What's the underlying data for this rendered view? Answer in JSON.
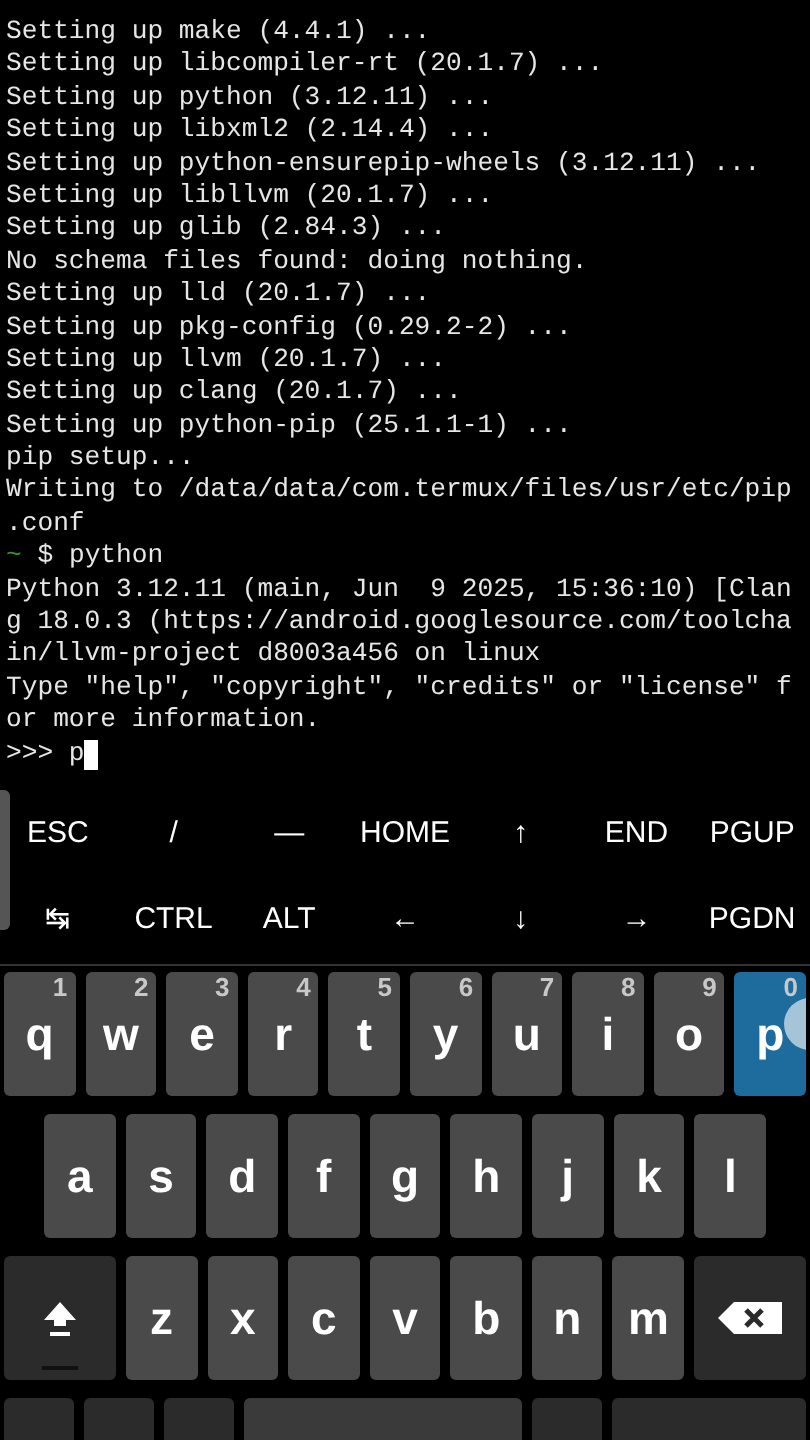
{
  "terminal": {
    "lines": [
      {
        "text": "Setting up make (4.4.1) ..."
      },
      {
        "text": "Setting up libcompiler-rt (20.1.7) ..."
      },
      {
        "text": "Setting up python (3.12.11) ..."
      },
      {
        "text": "Setting up libxml2 (2.14.4) ..."
      },
      {
        "text": "Setting up python-ensurepip-wheels (3.12.11) ..."
      },
      {
        "text": "Setting up libllvm (20.1.7) ..."
      },
      {
        "text": "Setting up glib (2.84.3) ..."
      },
      {
        "text": "No schema files found: doing nothing."
      },
      {
        "text": "Setting up lld (20.1.7) ..."
      },
      {
        "text": "Setting up pkg-config (0.29.2-2) ..."
      },
      {
        "text": "Setting up llvm (20.1.7) ..."
      },
      {
        "text": "Setting up clang (20.1.7) ..."
      },
      {
        "text": "Setting up python-pip (25.1.1-1) ..."
      },
      {
        "text": "pip setup..."
      },
      {
        "text": "Writing to /data/data/com.termux/files/usr/etc/pip"
      },
      {
        "text": ".conf"
      },
      {
        "prompt": "~",
        "text": "$ python"
      },
      {
        "text": "Python 3.12.11 (main, Jun  9 2025, 15:36:10) [Clan"
      },
      {
        "text": "g 18.0.3 (https://android.googlesource.com/toolcha"
      },
      {
        "text": "in/llvm-project d8003a456 on linux"
      },
      {
        "text": "Type \"help\", \"copyright\", \"credits\" or \"license\" f"
      },
      {
        "text": "or more information."
      },
      {
        "text": ">>> p",
        "cursor": true
      }
    ]
  },
  "extra_keys": [
    [
      "ESC",
      "/",
      "―",
      "HOME",
      "↑",
      "END",
      "PGUP"
    ],
    [
      "↹",
      "CTRL",
      "ALT",
      "←",
      "↓",
      "→",
      "PGDN"
    ]
  ],
  "keyboard": {
    "rows": [
      [
        {
          "kind": "letter",
          "label": "q",
          "hint": "1",
          "pressed": false
        },
        {
          "kind": "letter",
          "label": "w",
          "hint": "2",
          "pressed": false
        },
        {
          "kind": "letter",
          "label": "e",
          "hint": "3",
          "pressed": false
        },
        {
          "kind": "letter",
          "label": "r",
          "hint": "4",
          "pressed": false
        },
        {
          "kind": "letter",
          "label": "t",
          "hint": "5",
          "pressed": false
        },
        {
          "kind": "letter",
          "label": "y",
          "hint": "6",
          "pressed": false
        },
        {
          "kind": "letter",
          "label": "u",
          "hint": "7",
          "pressed": false
        },
        {
          "kind": "letter",
          "label": "i",
          "hint": "8",
          "pressed": false
        },
        {
          "kind": "letter",
          "label": "o",
          "hint": "9",
          "pressed": false
        },
        {
          "kind": "letter",
          "label": "p",
          "hint": "0",
          "pressed": true
        }
      ],
      [
        {
          "kind": "letter",
          "label": "a",
          "pressed": false
        },
        {
          "kind": "letter",
          "label": "s",
          "pressed": false
        },
        {
          "kind": "letter",
          "label": "d",
          "pressed": false
        },
        {
          "kind": "letter",
          "label": "f",
          "pressed": false
        },
        {
          "kind": "letter",
          "label": "g",
          "pressed": false
        },
        {
          "kind": "letter",
          "label": "h",
          "pressed": false
        },
        {
          "kind": "letter",
          "label": "j",
          "pressed": false
        },
        {
          "kind": "letter",
          "label": "k",
          "pressed": false
        },
        {
          "kind": "letter",
          "label": "l",
          "pressed": false
        }
      ],
      [
        {
          "kind": "shift"
        },
        {
          "kind": "letter",
          "label": "z",
          "pressed": false
        },
        {
          "kind": "letter",
          "label": "x",
          "pressed": false
        },
        {
          "kind": "letter",
          "label": "c",
          "pressed": false
        },
        {
          "kind": "letter",
          "label": "v",
          "pressed": false
        },
        {
          "kind": "letter",
          "label": "b",
          "pressed": false
        },
        {
          "kind": "letter",
          "label": "n",
          "pressed": false
        },
        {
          "kind": "letter",
          "label": "m",
          "pressed": false
        },
        {
          "kind": "backspace"
        }
      ],
      [
        {
          "kind": "blank"
        },
        {
          "kind": "blank"
        },
        {
          "kind": "blank"
        },
        {
          "kind": "space"
        },
        {
          "kind": "blank"
        },
        {
          "kind": "wide"
        }
      ]
    ]
  }
}
